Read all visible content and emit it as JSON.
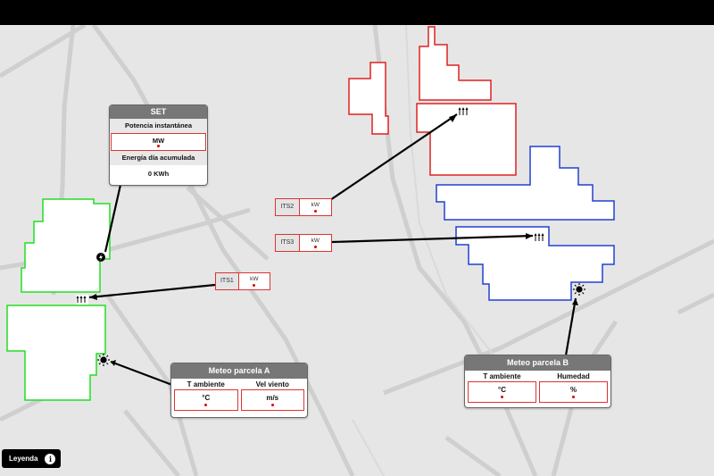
{
  "set_panel": {
    "title": "SET",
    "power_label": "Potencia instantánea",
    "power_unit": "MW",
    "energy_label": "Energía día acumulada",
    "energy_value": "0 KWh"
  },
  "its_boxes": [
    {
      "name": "ITS1",
      "unit": "kW"
    },
    {
      "name": "ITS2",
      "unit": "kW"
    },
    {
      "name": "ITS3",
      "unit": "kW"
    }
  ],
  "meteo_a": {
    "title": "Meteo parcela A",
    "col1_label": "T ambiente",
    "col1_unit": "°C",
    "col2_label": "Vel viento",
    "col2_unit": "m/s"
  },
  "meteo_b": {
    "title": "Meteo parcela B",
    "col1_label": "T ambiente",
    "col1_unit": "°C",
    "col2_label": "Humedad",
    "col2_unit": "%"
  },
  "legend": {
    "label": "Leyenda",
    "info_glyph": "i"
  },
  "colors": {
    "parcel_green": "#22dd22",
    "parcel_red": "#e02020",
    "parcel_blue": "#2040d0",
    "alert_dot": "#dd0000"
  },
  "icons": [
    "lightning-icon",
    "inverter-icon",
    "sun-icon",
    "info-icon"
  ]
}
